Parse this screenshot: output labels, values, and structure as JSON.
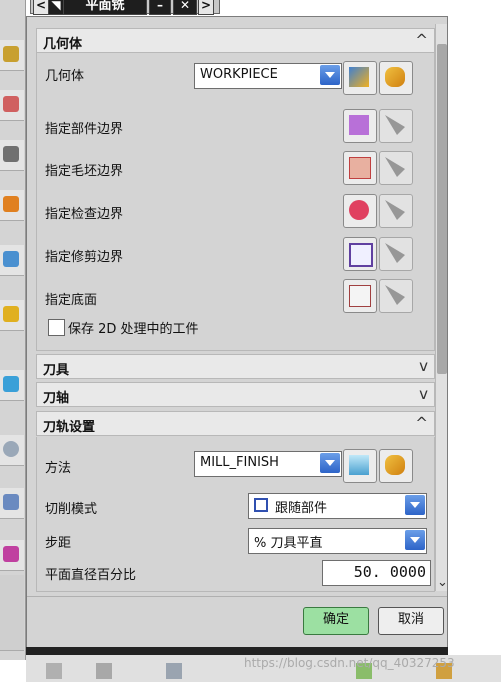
{
  "titlebar": {
    "prev": "<",
    "arrow": "◥",
    "title": "平面铣",
    "minimize": "–",
    "close": "✕",
    "next": ">"
  },
  "sections": {
    "geometry": {
      "title": "几何体",
      "collapse": "^",
      "rows": {
        "geometry_label": "几何体",
        "geometry_value": "WORKPIECE",
        "part_boundary": "指定部件边界",
        "blank_boundary": "指定毛坯边界",
        "check_boundary": "指定检查边界",
        "trim_boundary": "指定修剪边界",
        "floor": "指定底面",
        "save_2d_label": "保存 2D 处理中的工件"
      }
    },
    "tool": {
      "title": "刀具",
      "collapse": "v"
    },
    "axis": {
      "title": "刀轴",
      "collapse": "v"
    },
    "path_settings": {
      "title": "刀轨设置",
      "collapse": "^",
      "method_label": "方法",
      "method_value": "MILL_FINISH",
      "cut_pattern_label": "切削模式",
      "cut_pattern_value": "跟随部件",
      "stepover_label": "步距",
      "stepover_value": "% 刀具平直",
      "flat_percent_label": "平面直径百分比",
      "flat_percent_value": "50. 0000"
    }
  },
  "footer": {
    "ok": "确定",
    "cancel": "取消"
  },
  "watermark": "https://blog.csdn.net/qq_40327253",
  "colors": {
    "dialog_bg": "#d4d4d4",
    "ok_button": "#9ce0a2",
    "dropdown_accent": "#2d64c8"
  }
}
